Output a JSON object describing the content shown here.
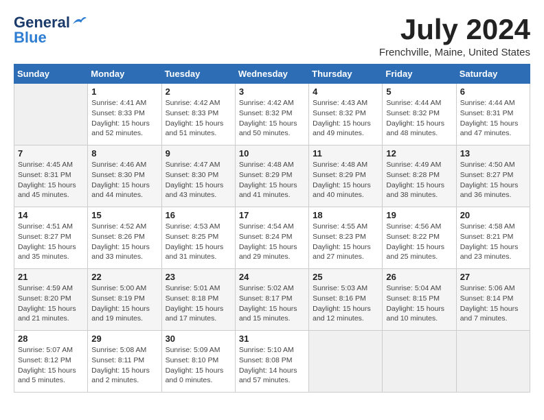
{
  "header": {
    "logo_line1": "General",
    "logo_line2": "Blue",
    "month": "July 2024",
    "location": "Frenchville, Maine, United States"
  },
  "weekdays": [
    "Sunday",
    "Monday",
    "Tuesday",
    "Wednesday",
    "Thursday",
    "Friday",
    "Saturday"
  ],
  "weeks": [
    [
      {
        "day": "",
        "sunrise": "",
        "sunset": "",
        "daylight": ""
      },
      {
        "day": "1",
        "sunrise": "Sunrise: 4:41 AM",
        "sunset": "Sunset: 8:33 PM",
        "daylight": "Daylight: 15 hours and 52 minutes."
      },
      {
        "day": "2",
        "sunrise": "Sunrise: 4:42 AM",
        "sunset": "Sunset: 8:33 PM",
        "daylight": "Daylight: 15 hours and 51 minutes."
      },
      {
        "day": "3",
        "sunrise": "Sunrise: 4:42 AM",
        "sunset": "Sunset: 8:32 PM",
        "daylight": "Daylight: 15 hours and 50 minutes."
      },
      {
        "day": "4",
        "sunrise": "Sunrise: 4:43 AM",
        "sunset": "Sunset: 8:32 PM",
        "daylight": "Daylight: 15 hours and 49 minutes."
      },
      {
        "day": "5",
        "sunrise": "Sunrise: 4:44 AM",
        "sunset": "Sunset: 8:32 PM",
        "daylight": "Daylight: 15 hours and 48 minutes."
      },
      {
        "day": "6",
        "sunrise": "Sunrise: 4:44 AM",
        "sunset": "Sunset: 8:31 PM",
        "daylight": "Daylight: 15 hours and 47 minutes."
      }
    ],
    [
      {
        "day": "7",
        "sunrise": "Sunrise: 4:45 AM",
        "sunset": "Sunset: 8:31 PM",
        "daylight": "Daylight: 15 hours and 45 minutes."
      },
      {
        "day": "8",
        "sunrise": "Sunrise: 4:46 AM",
        "sunset": "Sunset: 8:30 PM",
        "daylight": "Daylight: 15 hours and 44 minutes."
      },
      {
        "day": "9",
        "sunrise": "Sunrise: 4:47 AM",
        "sunset": "Sunset: 8:30 PM",
        "daylight": "Daylight: 15 hours and 43 minutes."
      },
      {
        "day": "10",
        "sunrise": "Sunrise: 4:48 AM",
        "sunset": "Sunset: 8:29 PM",
        "daylight": "Daylight: 15 hours and 41 minutes."
      },
      {
        "day": "11",
        "sunrise": "Sunrise: 4:48 AM",
        "sunset": "Sunset: 8:29 PM",
        "daylight": "Daylight: 15 hours and 40 minutes."
      },
      {
        "day": "12",
        "sunrise": "Sunrise: 4:49 AM",
        "sunset": "Sunset: 8:28 PM",
        "daylight": "Daylight: 15 hours and 38 minutes."
      },
      {
        "day": "13",
        "sunrise": "Sunrise: 4:50 AM",
        "sunset": "Sunset: 8:27 PM",
        "daylight": "Daylight: 15 hours and 36 minutes."
      }
    ],
    [
      {
        "day": "14",
        "sunrise": "Sunrise: 4:51 AM",
        "sunset": "Sunset: 8:27 PM",
        "daylight": "Daylight: 15 hours and 35 minutes."
      },
      {
        "day": "15",
        "sunrise": "Sunrise: 4:52 AM",
        "sunset": "Sunset: 8:26 PM",
        "daylight": "Daylight: 15 hours and 33 minutes."
      },
      {
        "day": "16",
        "sunrise": "Sunrise: 4:53 AM",
        "sunset": "Sunset: 8:25 PM",
        "daylight": "Daylight: 15 hours and 31 minutes."
      },
      {
        "day": "17",
        "sunrise": "Sunrise: 4:54 AM",
        "sunset": "Sunset: 8:24 PM",
        "daylight": "Daylight: 15 hours and 29 minutes."
      },
      {
        "day": "18",
        "sunrise": "Sunrise: 4:55 AM",
        "sunset": "Sunset: 8:23 PM",
        "daylight": "Daylight: 15 hours and 27 minutes."
      },
      {
        "day": "19",
        "sunrise": "Sunrise: 4:56 AM",
        "sunset": "Sunset: 8:22 PM",
        "daylight": "Daylight: 15 hours and 25 minutes."
      },
      {
        "day": "20",
        "sunrise": "Sunrise: 4:58 AM",
        "sunset": "Sunset: 8:21 PM",
        "daylight": "Daylight: 15 hours and 23 minutes."
      }
    ],
    [
      {
        "day": "21",
        "sunrise": "Sunrise: 4:59 AM",
        "sunset": "Sunset: 8:20 PM",
        "daylight": "Daylight: 15 hours and 21 minutes."
      },
      {
        "day": "22",
        "sunrise": "Sunrise: 5:00 AM",
        "sunset": "Sunset: 8:19 PM",
        "daylight": "Daylight: 15 hours and 19 minutes."
      },
      {
        "day": "23",
        "sunrise": "Sunrise: 5:01 AM",
        "sunset": "Sunset: 8:18 PM",
        "daylight": "Daylight: 15 hours and 17 minutes."
      },
      {
        "day": "24",
        "sunrise": "Sunrise: 5:02 AM",
        "sunset": "Sunset: 8:17 PM",
        "daylight": "Daylight: 15 hours and 15 minutes."
      },
      {
        "day": "25",
        "sunrise": "Sunrise: 5:03 AM",
        "sunset": "Sunset: 8:16 PM",
        "daylight": "Daylight: 15 hours and 12 minutes."
      },
      {
        "day": "26",
        "sunrise": "Sunrise: 5:04 AM",
        "sunset": "Sunset: 8:15 PM",
        "daylight": "Daylight: 15 hours and 10 minutes."
      },
      {
        "day": "27",
        "sunrise": "Sunrise: 5:06 AM",
        "sunset": "Sunset: 8:14 PM",
        "daylight": "Daylight: 15 hours and 7 minutes."
      }
    ],
    [
      {
        "day": "28",
        "sunrise": "Sunrise: 5:07 AM",
        "sunset": "Sunset: 8:12 PM",
        "daylight": "Daylight: 15 hours and 5 minutes."
      },
      {
        "day": "29",
        "sunrise": "Sunrise: 5:08 AM",
        "sunset": "Sunset: 8:11 PM",
        "daylight": "Daylight: 15 hours and 2 minutes."
      },
      {
        "day": "30",
        "sunrise": "Sunrise: 5:09 AM",
        "sunset": "Sunset: 8:10 PM",
        "daylight": "Daylight: 15 hours and 0 minutes."
      },
      {
        "day": "31",
        "sunrise": "Sunrise: 5:10 AM",
        "sunset": "Sunset: 8:08 PM",
        "daylight": "Daylight: 14 hours and 57 minutes."
      },
      {
        "day": "",
        "sunrise": "",
        "sunset": "",
        "daylight": ""
      },
      {
        "day": "",
        "sunrise": "",
        "sunset": "",
        "daylight": ""
      },
      {
        "day": "",
        "sunrise": "",
        "sunset": "",
        "daylight": ""
      }
    ]
  ]
}
